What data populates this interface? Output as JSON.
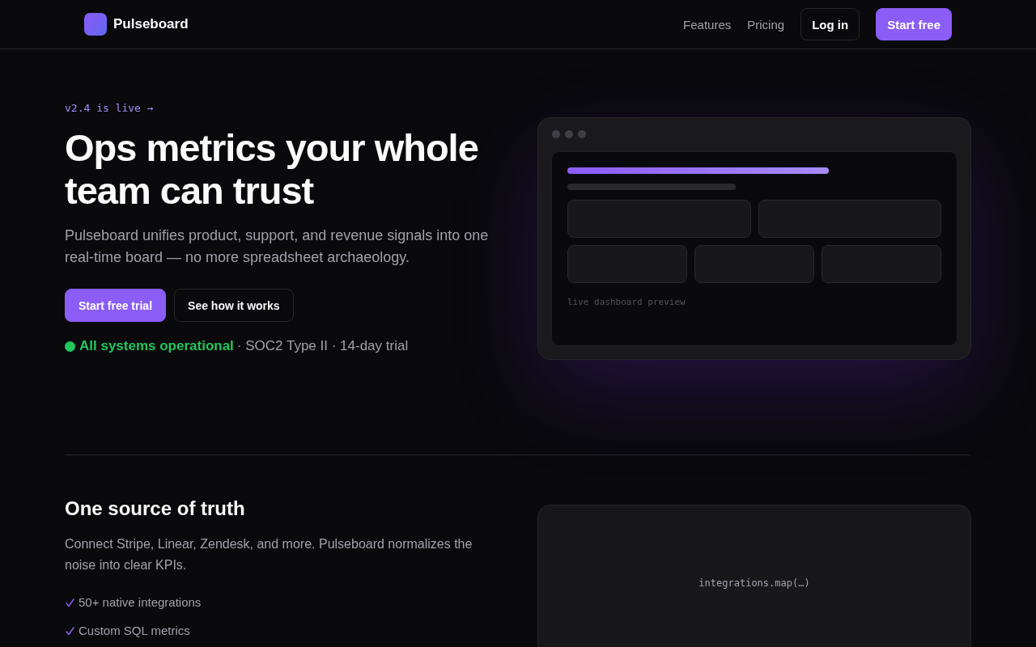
{
  "nav": {
    "brand": "Pulseboard",
    "links": [
      {
        "label": "Features"
      },
      {
        "label": "Pricing"
      }
    ],
    "login_button": "Log in",
    "signup_button": "Start free"
  },
  "hero": {
    "announcement": "v2.4 is live →",
    "title": "Ops metrics your whole team can trust",
    "lead": "Pulseboard unifies product, support, and revenue signals into one real-time board — no more spreadsheet archaeology.",
    "buttons": [
      {
        "label": "Start free trial",
        "kind": "primary"
      },
      {
        "label": "See how it works",
        "kind": "secondary"
      }
    ],
    "status": {
      "label": "All systems operational",
      "operational": true
    },
    "trust_notes": "· SOC2 Type II · 14-day trial",
    "preview": {
      "caption": "live dashboard preview"
    }
  },
  "integrations": {
    "title": "One source of truth",
    "body": "Connect Stripe, Linear, Zendesk, and more. Pulseboard normalizes the noise into clear KPIs.",
    "checklist": [
      "50+ native integrations",
      "Custom SQL metrics"
    ],
    "panel": {
      "code": "integrations.map(…)"
    }
  }
}
